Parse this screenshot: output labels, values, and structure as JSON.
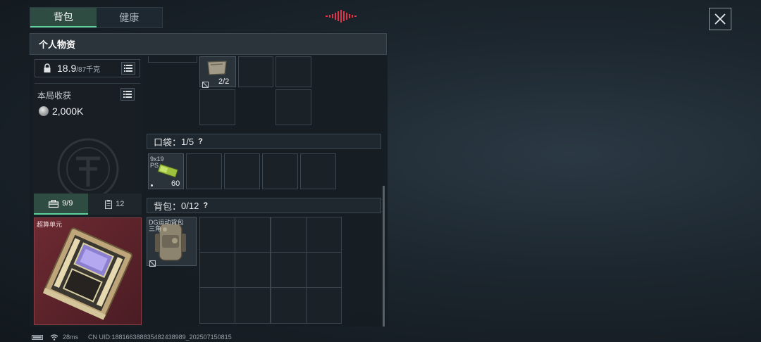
{
  "tabs": [
    {
      "label": "背包",
      "active": true
    },
    {
      "label": "健康",
      "active": false
    }
  ],
  "panel": {
    "title": "个人物资"
  },
  "weight": {
    "current": "18.9",
    "max": "/87千克"
  },
  "harvest": {
    "label": "本局收获",
    "value": "2,000K"
  },
  "sub_tabs": [
    {
      "icon": "toolbox-icon",
      "label": "9/9",
      "active": true
    },
    {
      "icon": "clipboard-icon",
      "label": "12",
      "active": false
    }
  ],
  "featured_item": {
    "label": "超算单元"
  },
  "chest_item": {
    "count": "2/2"
  },
  "pocket": {
    "label": "口袋：",
    "value": "1/5",
    "help": "?"
  },
  "pocket_item": {
    "name": "9x19 PS",
    "count": "60"
  },
  "backpack": {
    "label": "背包：",
    "value": "0/12",
    "help": "?"
  },
  "backpack_item": {
    "name": "DG运动背包 三角"
  },
  "status": {
    "ping": "28ms",
    "uid": "CN UID:18816638883548243898​9_202507150815"
  },
  "colors": {
    "accent": "#5fd39b",
    "active_tab_bg": "#2e4c42",
    "featured_bg": "#6e2a32",
    "signal": "#e0344a"
  }
}
